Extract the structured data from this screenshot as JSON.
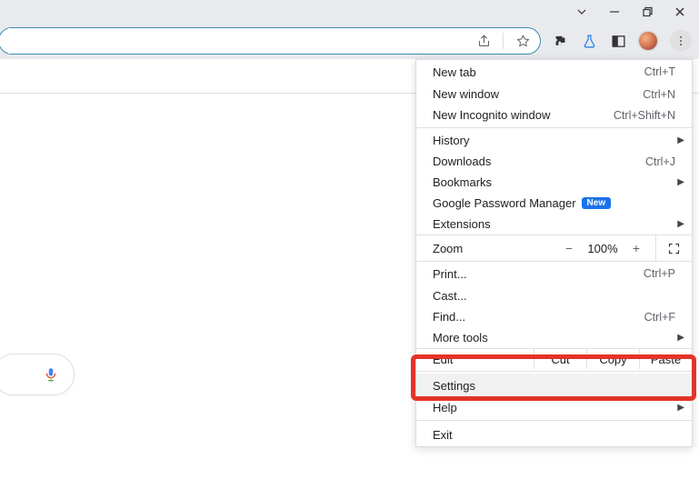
{
  "titlebar": {
    "dropdown": "chevron-down",
    "minimize": "minimize",
    "maximize": "maximize-restore",
    "close": "close"
  },
  "omnibox": {
    "value": "",
    "share": "share-icon",
    "star": "star-icon"
  },
  "toolbar_icons": {
    "extensions": "puzzle-icon",
    "labs": "flask-icon",
    "reading": "square-icon",
    "profile": "avatar",
    "menu": "kebab-icon"
  },
  "menu": {
    "section1": [
      {
        "label": "New tab",
        "shortcut": "Ctrl+T"
      },
      {
        "label": "New window",
        "shortcut": "Ctrl+N"
      },
      {
        "label": "New Incognito window",
        "shortcut": "Ctrl+Shift+N"
      }
    ],
    "section2": [
      {
        "label": "History",
        "submenu": true
      },
      {
        "label": "Downloads",
        "shortcut": "Ctrl+J"
      },
      {
        "label": "Bookmarks",
        "submenu": true
      },
      {
        "label": "Google Password Manager",
        "badge": "New"
      },
      {
        "label": "Extensions",
        "submenu": true
      }
    ],
    "zoom": {
      "label": "Zoom",
      "minus": "−",
      "value": "100%",
      "plus": "+"
    },
    "section3": [
      {
        "label": "Print...",
        "shortcut": "Ctrl+P"
      },
      {
        "label": "Cast..."
      },
      {
        "label": "Find...",
        "shortcut": "Ctrl+F"
      },
      {
        "label": "More tools",
        "submenu": true
      }
    ],
    "edit": {
      "label": "Edit",
      "cut": "Cut",
      "copy": "Copy",
      "paste": "Paste"
    },
    "section4": [
      {
        "label": "Settings"
      },
      {
        "label": "Help",
        "submenu": true
      }
    ],
    "section5": [
      {
        "label": "Exit"
      }
    ],
    "highlighted": "Settings"
  }
}
